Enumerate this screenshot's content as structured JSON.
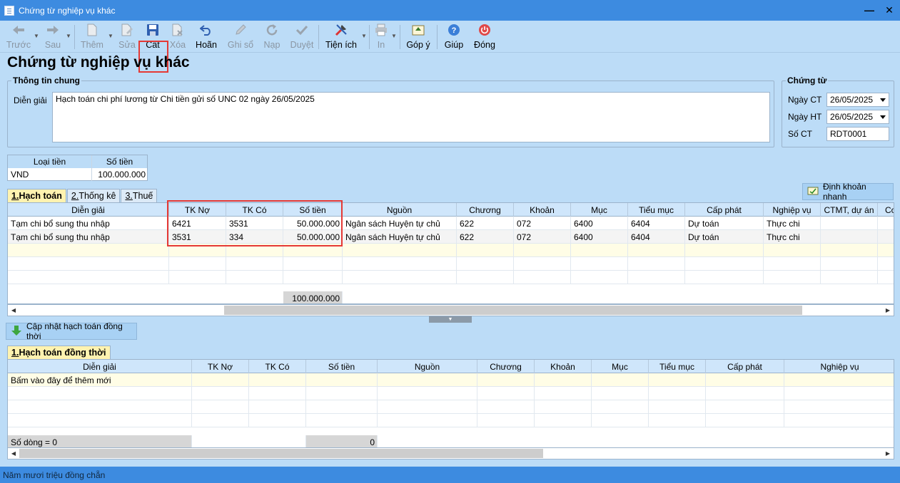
{
  "window": {
    "title": "Chứng từ nghiệp vụ khác"
  },
  "toolbar": {
    "prev": "Trước",
    "next": "Sau",
    "add": "Thêm",
    "edit": "Sửa",
    "save": "Cất",
    "delete": "Xóa",
    "undo": "Hoãn",
    "post": "Ghi sổ",
    "reload": "Nạp",
    "approve": "Duyệt",
    "utilities": "Tiện ích",
    "print": "In",
    "feedback": "Góp ý",
    "help": "Giúp",
    "close": "Đóng"
  },
  "page_title": "Chứng từ nghiệp vụ khác",
  "general": {
    "group_title": "Thông tin chung",
    "desc_label": "Diễn giải",
    "desc_value": "Hạch toán chi phí lương từ Chi tiền gửi số UNC  02 ngày 26/05/2025"
  },
  "voucher": {
    "group_title": "Chứng từ",
    "date_label": "Ngày CT",
    "date_value": "26/05/2025",
    "post_date_label": "Ngày HT",
    "post_date_value": "26/05/2025",
    "number_label": "Số CT",
    "number_value": "RDT0001"
  },
  "currency": {
    "col_type": "Loại tiền",
    "col_amount": "Số tiền",
    "type": "VND",
    "amount": "100.000.000"
  },
  "tabs": [
    {
      "num": "1.",
      "label": " Hạch toán"
    },
    {
      "num": "2.",
      "label": " Thống kê"
    },
    {
      "num": "3.",
      "label": " Thuế"
    }
  ],
  "quick_entry": "Định khoản nhanh",
  "main_grid": {
    "headers": [
      "Diễn giải",
      "TK Nợ",
      "TK Có",
      "Số tiền",
      "Nguồn",
      "Chương",
      "Khoản",
      "Mục",
      "Tiểu mục",
      "Cấp phát",
      "Nghiệp vụ",
      "CTMT, dự án",
      "Cơ"
    ],
    "rows": [
      [
        "Tạm chi bổ sung thu nhập",
        "6421",
        "3531",
        "50.000.000",
        "Ngân sách Huyện tự chủ",
        "622",
        "072",
        "6400",
        "6404",
        "Dự toán",
        "Thực chi",
        ""
      ],
      [
        "Tạm chi bổ sung thu nhập",
        "3531",
        "334",
        "50.000.000",
        "Ngân sách Huyện tự chủ",
        "622",
        "072",
        "6400",
        "6404",
        "Dự toán",
        "Thực chi",
        ""
      ]
    ],
    "total": "100.000.000"
  },
  "update_button": "Cập nhật hạch toán đồng thời",
  "sub_tab": {
    "num": "1.",
    "label": " Hạch toán đồng thời"
  },
  "sub_grid": {
    "headers": [
      "Diễn giải",
      "TK Nợ",
      "TK Có",
      "Số tiền",
      "Nguồn",
      "Chương",
      "Khoản",
      "Mục",
      "Tiểu mục",
      "Cấp phát",
      "Nghiệp vụ"
    ],
    "placeholder_row": "Bấm vào đây để thêm mới",
    "row_count": "Số dòng = 0",
    "total": "0"
  },
  "status": "Năm mươi triệu đồng chẵn",
  "colors": {
    "titlebar": "#3d8be0",
    "background": "#bcdcf7",
    "highlight": "#e53935"
  }
}
